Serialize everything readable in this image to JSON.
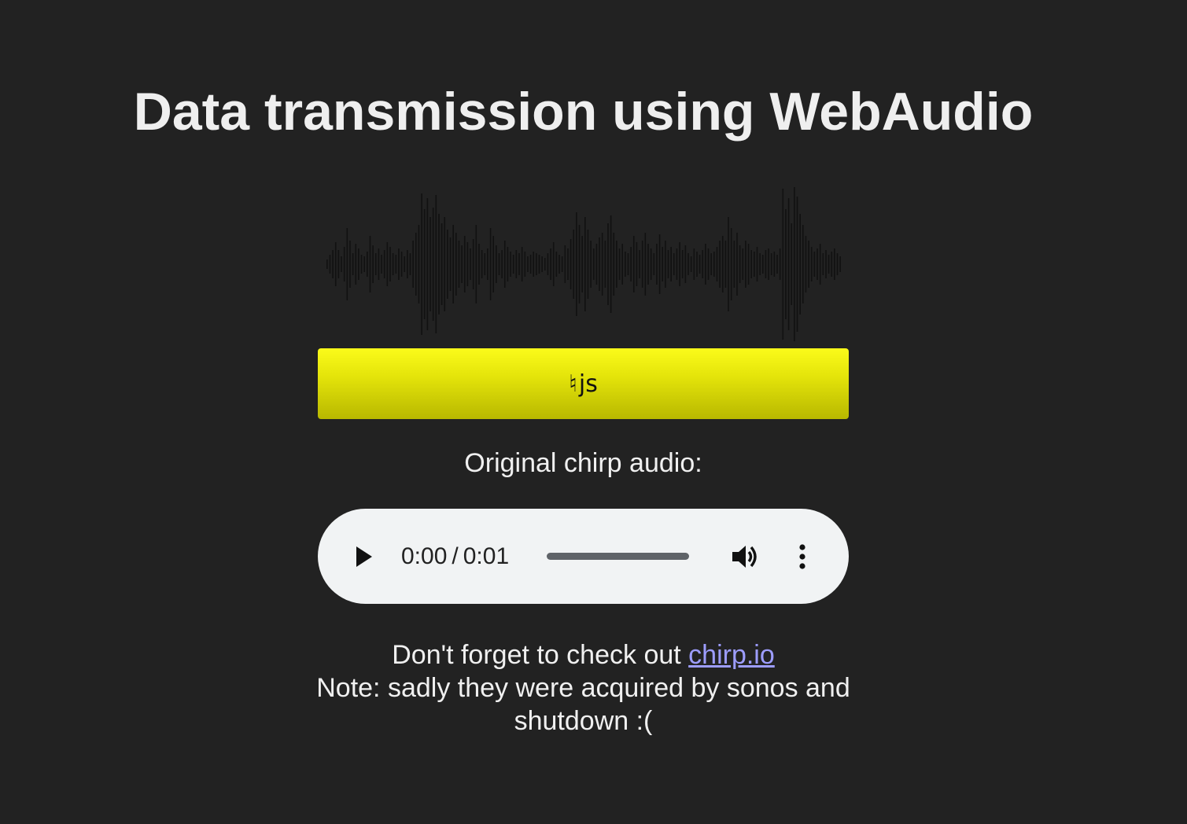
{
  "page": {
    "title": "Data transmission using WebAudio"
  },
  "chirp_button": {
    "glyph": "♮",
    "label": "js"
  },
  "audio": {
    "caption": "Original chirp audio:",
    "current_time": "0:00",
    "separator": "/",
    "duration": "0:01",
    "progress_fraction": 0,
    "play_icon": "play-icon",
    "volume_icon": "volume-icon",
    "more_icon": "more-vert-icon"
  },
  "footer": {
    "prefix": "Don't forget to check out ",
    "link_text": "chirp.io",
    "note": "Note: sadly they were acquired by sonos and shutdown :("
  },
  "colors": {
    "background": "#222222",
    "button_top": "#fbfb1a",
    "button_bottom": "#b8b800",
    "link": "#9d9dff",
    "player_bg": "#f1f3f4",
    "waveform": "#111111"
  },
  "waveform_amplitudes": [
    0.06,
    0.12,
    0.18,
    0.28,
    0.18,
    0.1,
    0.22,
    0.46,
    0.3,
    0.14,
    0.26,
    0.2,
    0.12,
    0.1,
    0.16,
    0.36,
    0.24,
    0.14,
    0.2,
    0.12,
    0.18,
    0.28,
    0.22,
    0.14,
    0.12,
    0.2,
    0.16,
    0.1,
    0.18,
    0.14,
    0.3,
    0.4,
    0.5,
    0.9,
    0.7,
    0.84,
    0.6,
    0.72,
    0.88,
    0.64,
    0.52,
    0.6,
    0.44,
    0.34,
    0.5,
    0.4,
    0.3,
    0.24,
    0.36,
    0.28,
    0.2,
    0.32,
    0.5,
    0.26,
    0.18,
    0.14,
    0.2,
    0.46,
    0.36,
    0.24,
    0.14,
    0.18,
    0.3,
    0.22,
    0.16,
    0.12,
    0.18,
    0.14,
    0.22,
    0.16,
    0.1,
    0.12,
    0.16,
    0.14,
    0.12,
    0.1,
    0.08,
    0.14,
    0.2,
    0.28,
    0.16,
    0.12,
    0.1,
    0.24,
    0.2,
    0.32,
    0.44,
    0.66,
    0.5,
    0.36,
    0.6,
    0.44,
    0.3,
    0.2,
    0.26,
    0.34,
    0.4,
    0.3,
    0.52,
    0.62,
    0.4,
    0.3,
    0.2,
    0.26,
    0.16,
    0.14,
    0.22,
    0.36,
    0.28,
    0.18,
    0.3,
    0.4,
    0.26,
    0.2,
    0.14,
    0.26,
    0.38,
    0.22,
    0.3,
    0.18,
    0.22,
    0.14,
    0.2,
    0.28,
    0.18,
    0.24,
    0.14,
    0.1,
    0.2,
    0.16,
    0.12,
    0.18,
    0.26,
    0.2,
    0.14,
    0.16,
    0.22,
    0.3,
    0.36,
    0.3,
    0.6,
    0.46,
    0.3,
    0.4,
    0.24,
    0.2,
    0.3,
    0.26,
    0.18,
    0.16,
    0.22,
    0.14,
    0.12,
    0.18,
    0.2,
    0.14,
    0.16,
    0.12,
    0.2,
    0.96,
    0.7,
    0.84,
    0.52,
    0.98,
    0.86,
    0.64,
    0.5,
    0.36,
    0.3,
    0.22,
    0.16,
    0.2,
    0.26,
    0.14,
    0.18,
    0.12,
    0.16,
    0.2,
    0.14,
    0.1
  ]
}
